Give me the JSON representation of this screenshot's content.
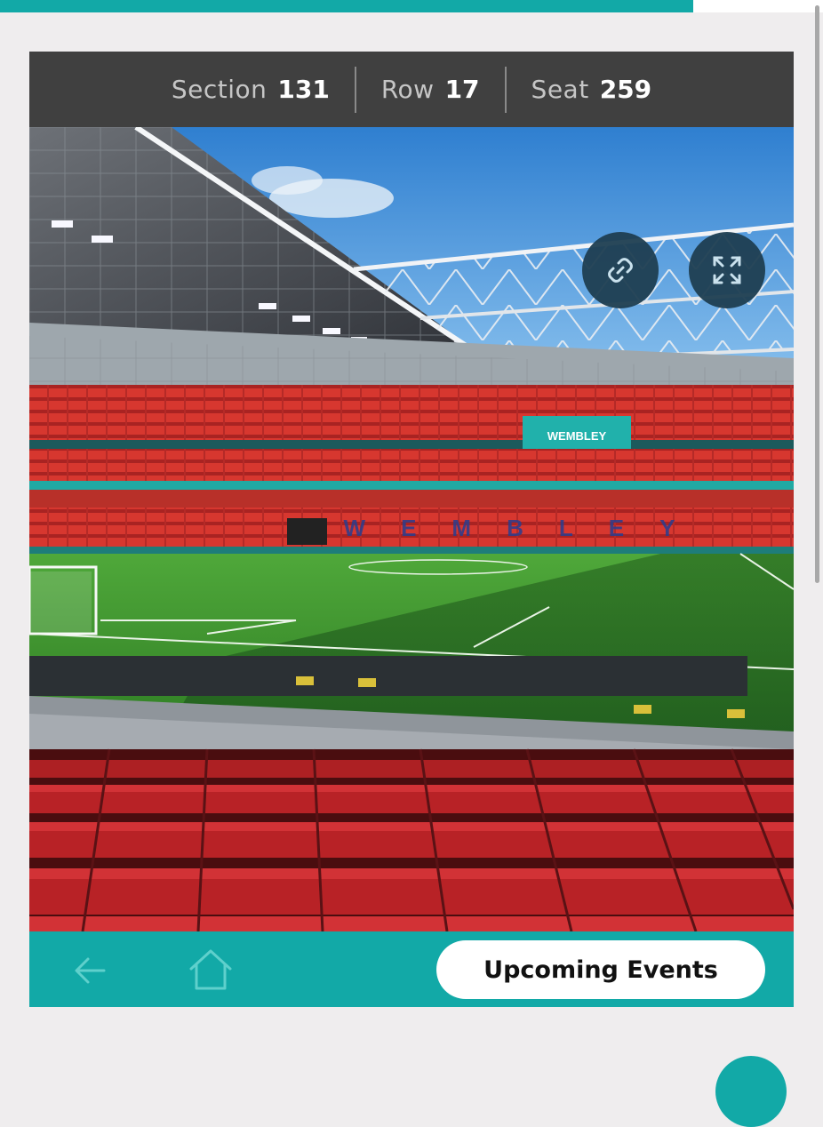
{
  "header": {
    "section_label": "Section",
    "section_value": "131",
    "row_label": "Row",
    "row_value": "17",
    "seat_label": "Seat",
    "seat_value": "259"
  },
  "viewer": {
    "board_text": "WEMBLEY",
    "stand_text": "WEMBLEY",
    "link_icon": "link-icon",
    "expand_icon": "expand-icon"
  },
  "footer": {
    "back_icon": "arrow-left-icon",
    "home_icon": "home-icon",
    "events_label": "Upcoming Events"
  },
  "colors": {
    "accent": "#12a9a7",
    "header_bg": "#404040",
    "round_button": "#1f3f52",
    "seats": "#c8262b",
    "pitch": "#3b8a2c"
  }
}
